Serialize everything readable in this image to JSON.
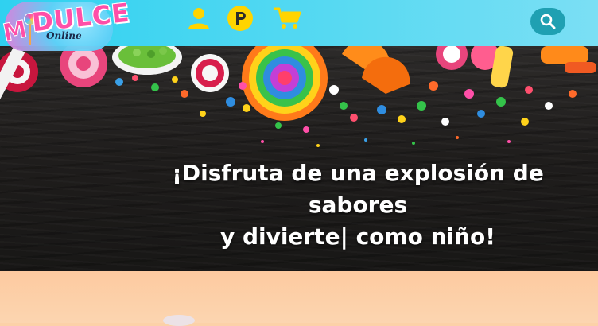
{
  "brand": {
    "logo_word": "DULCE",
    "logo_initial": "M",
    "logo_tagline": "Online"
  },
  "nav": {
    "icons": [
      "user-icon",
      "p-coin-icon",
      "shopping-cart-icon",
      "search-icon"
    ],
    "colors": {
      "bar": "#4fd6f2",
      "icon_yellow": "#ffd400",
      "search_button": "#1fa0b2"
    }
  },
  "hero": {
    "heading_line1": "¡Disfruta de una explosión de",
    "heading_line2": "sabores",
    "heading_line3": "y divierte| como niño!"
  }
}
